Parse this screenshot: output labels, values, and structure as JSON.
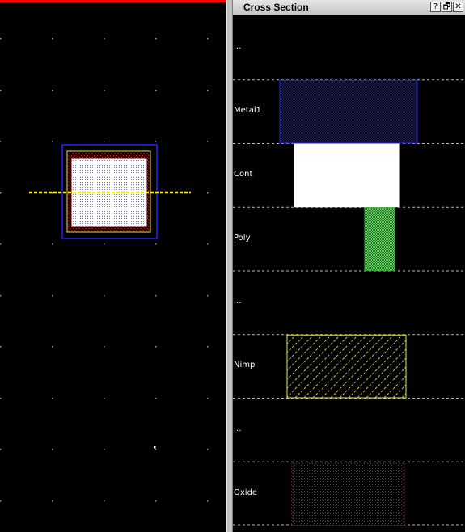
{
  "colors": {
    "background": "#000000",
    "grid_dot": "#9a9a9a",
    "metal1": "#2222ff",
    "nimp": "#e8e84a",
    "oxide": "#cc2222",
    "cont": "#ffffff",
    "poly": "#44cc44",
    "cut_line": "#ffee00",
    "selection_bar": "#ff0000"
  },
  "cross_section": {
    "title": "Cross Section",
    "help_glyph": "?",
    "restore_glyph": "🗗",
    "close_glyph": "✕",
    "layers": [
      {
        "name": "...",
        "shape": "none"
      },
      {
        "name": "Metal1",
        "shape": "metal1"
      },
      {
        "name": "Cont",
        "shape": "cont"
      },
      {
        "name": "Poly",
        "shape": "poly"
      },
      {
        "name": "...",
        "shape": "none"
      },
      {
        "name": "Nimp",
        "shape": "nimp"
      },
      {
        "name": "...",
        "shape": "none"
      },
      {
        "name": "Oxide",
        "shape": "oxide"
      }
    ]
  }
}
